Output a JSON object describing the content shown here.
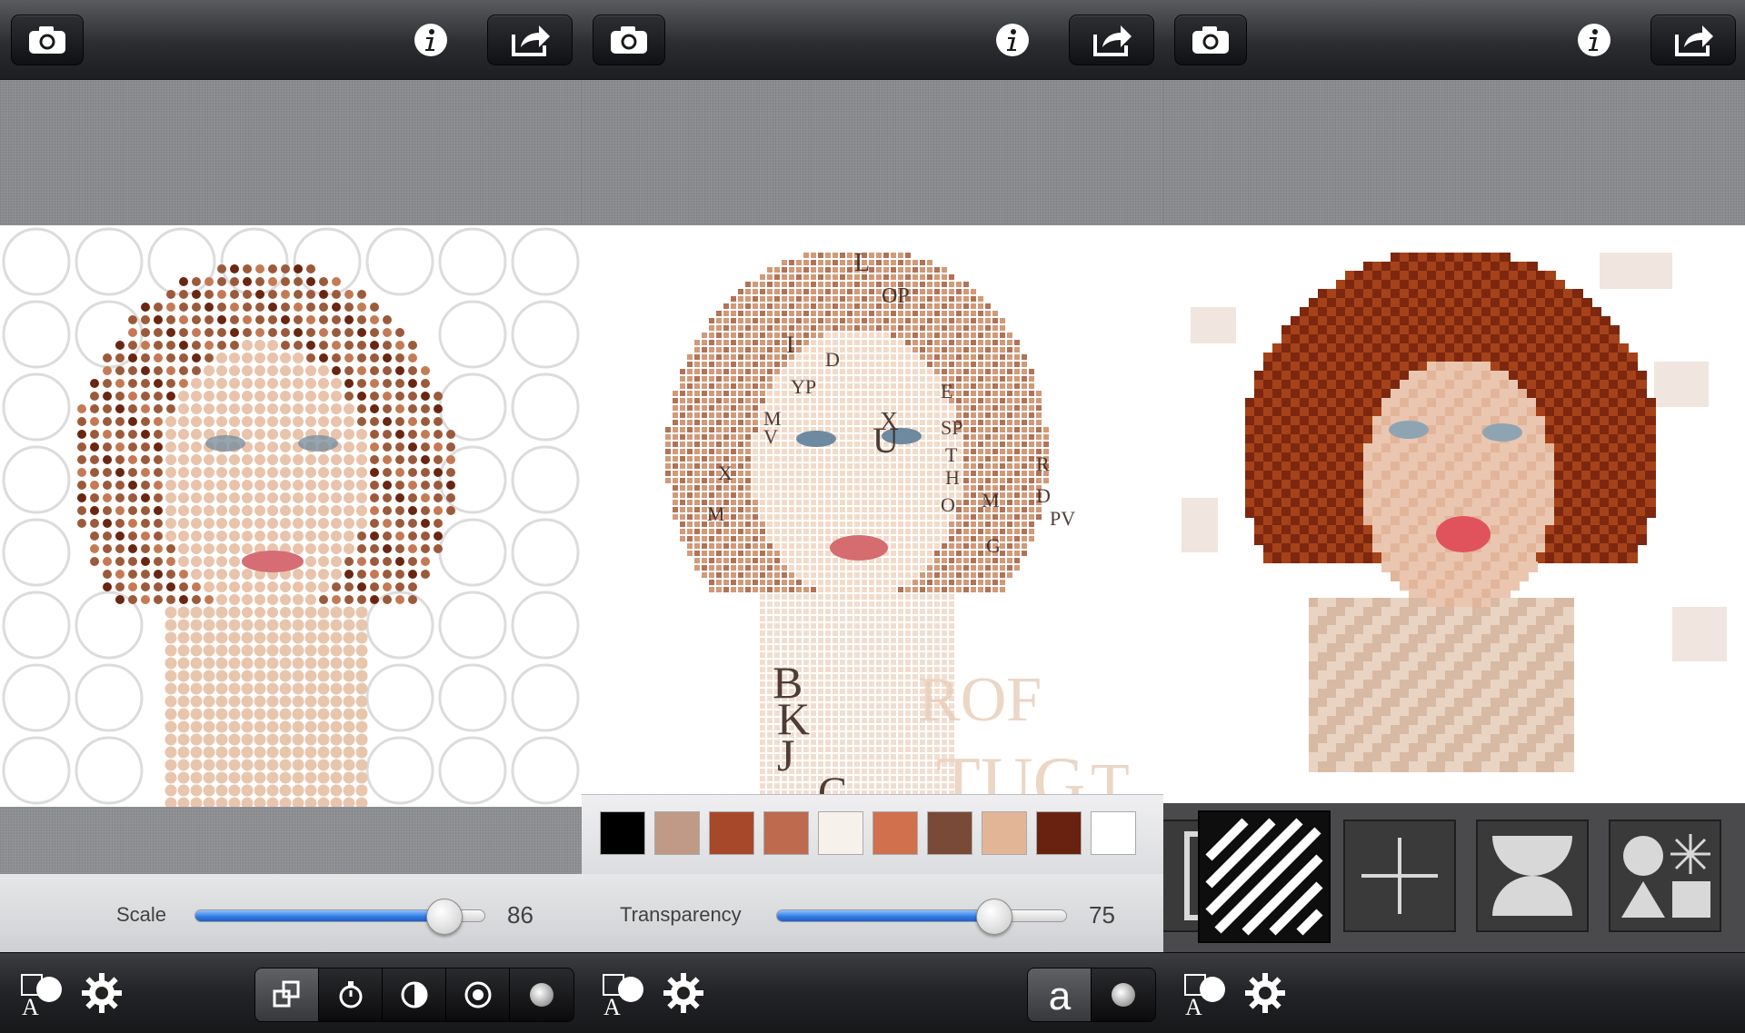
{
  "panels": [
    {
      "id": "circles",
      "slider": {
        "label": "Scale",
        "value": "86",
        "fraction": 0.86
      },
      "modes": [
        "resize-icon",
        "timer-icon",
        "contrast-icon",
        "target-icon",
        "dot-icon"
      ],
      "active_mode": 0
    },
    {
      "id": "letters",
      "slider": {
        "label": "Transparency",
        "value": "75",
        "fraction": 0.75
      },
      "letters": [
        "L",
        "OP",
        "I",
        "D",
        "X",
        "YP",
        "M",
        "V",
        "E",
        "SP",
        "X",
        "M",
        "U",
        "T",
        "H",
        "O",
        "M",
        "G",
        "R",
        "D",
        "PV",
        "B",
        "K",
        "J",
        "C",
        "ROF",
        "TUG",
        "T"
      ],
      "palette": [
        "#000000",
        "#c09a86",
        "#a8482a",
        "#bd6a4e",
        "#f7f1ec",
        "#d0704c",
        "#7a4a38",
        "#e3b597",
        "#6a2210",
        "#ffffff"
      ],
      "modes": [
        "letter-a-icon",
        "dot-icon"
      ],
      "active_mode": 0
    },
    {
      "id": "brush",
      "patterns": [
        "frame-icon",
        "diagonal-stripes-icon",
        "cross-icon",
        "hourglass-icon",
        "shapes-icon"
      ],
      "selected_pattern": 1
    }
  ],
  "icons": {
    "camera": "camera-icon",
    "info": "info-icon",
    "share": "share-icon",
    "shapes": "shapes-text-icon",
    "settings": "gear-icon"
  },
  "colors": {
    "skin": "#e9c3ab",
    "hair": "#a14a25",
    "slider_fill": "#2f7ae4"
  }
}
